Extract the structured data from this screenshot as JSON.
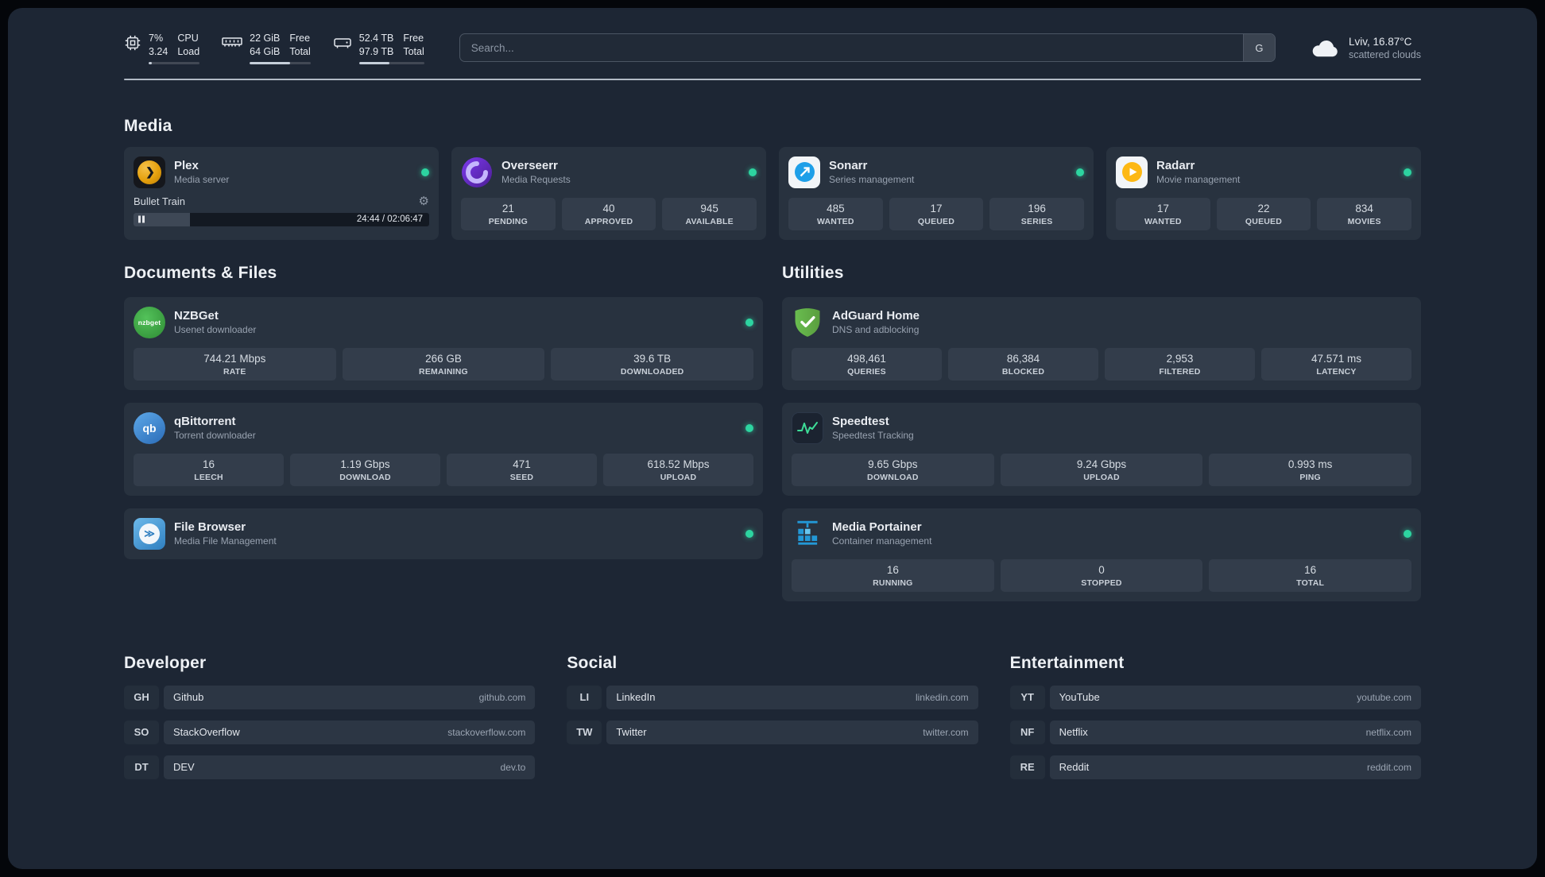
{
  "colors": {
    "background": "#1d2634",
    "card": "#28323f",
    "stat_tile": "#333d4b",
    "status_online": "#2dd4a0",
    "plex_accent": "#e5a00d",
    "overseerr_accent": "#7c3aed",
    "sonarr_accent": "#1e9fe8",
    "radarr_accent": "#fdb813",
    "nzbget_accent": "#3faa44",
    "qbittorrent_accent": "#4581d2",
    "filebrowser_accent": "#2f7fc0",
    "adguard_accent": "#69bd4f",
    "speedtest_accent": "#3ddc97",
    "portainer_accent": "#2398d6"
  },
  "topbar": {
    "cpu": {
      "icon": "cpu-chip-icon",
      "value_top": "7%",
      "value_bottom": "3.24",
      "label_top": "CPU",
      "label_bottom": "Load",
      "progress_percent": 7
    },
    "memory": {
      "icon": "memory-icon",
      "value_top": "22 GiB",
      "value_bottom": "64 GiB",
      "label_top": "Free",
      "label_bottom": "Total",
      "progress_percent": 66
    },
    "disk": {
      "icon": "hard-disk-icon",
      "value_top": "52.4 TB",
      "value_bottom": "97.9 TB",
      "label_top": "Free",
      "label_bottom": "Total",
      "progress_percent": 47
    },
    "search": {
      "placeholder": "Search...",
      "engine_button": "G"
    },
    "weather": {
      "icon": "cloud-icon",
      "location": "Lviv, 16.87°C",
      "condition": "scattered clouds"
    }
  },
  "media": {
    "title": "Media",
    "plex": {
      "name": "Plex",
      "subtitle": "Media server",
      "status": "online",
      "now_playing": "Bullet Train",
      "time_display": "24:44 / 02:06:47",
      "progress_percent": 19
    },
    "overseerr": {
      "name": "Overseerr",
      "subtitle": "Media Requests",
      "status": "online",
      "stats": [
        {
          "value": "21",
          "label": "PENDING"
        },
        {
          "value": "40",
          "label": "APPROVED"
        },
        {
          "value": "945",
          "label": "AVAILABLE"
        }
      ]
    },
    "sonarr": {
      "name": "Sonarr",
      "subtitle": "Series management",
      "status": "online",
      "stats": [
        {
          "value": "485",
          "label": "WANTED"
        },
        {
          "value": "17",
          "label": "QUEUED"
        },
        {
          "value": "196",
          "label": "SERIES"
        }
      ]
    },
    "radarr": {
      "name": "Radarr",
      "subtitle": "Movie management",
      "status": "online",
      "stats": [
        {
          "value": "17",
          "label": "WANTED"
        },
        {
          "value": "22",
          "label": "QUEUED"
        },
        {
          "value": "834",
          "label": "MOVIES"
        }
      ]
    }
  },
  "documents": {
    "title": "Documents & Files",
    "nzbget": {
      "name": "NZBGet",
      "subtitle": "Usenet downloader",
      "status": "online",
      "stats": [
        {
          "value": "744.21 Mbps",
          "label": "RATE"
        },
        {
          "value": "266 GB",
          "label": "REMAINING"
        },
        {
          "value": "39.6 TB",
          "label": "DOWNLOADED"
        }
      ]
    },
    "qbittorrent": {
      "name": "qBittorrent",
      "subtitle": "Torrent downloader",
      "status": "online",
      "stats": [
        {
          "value": "16",
          "label": "LEECH"
        },
        {
          "value": "1.19 Gbps",
          "label": "DOWNLOAD"
        },
        {
          "value": "471",
          "label": "SEED"
        },
        {
          "value": "618.52 Mbps",
          "label": "UPLOAD"
        }
      ]
    },
    "filebrowser": {
      "name": "File Browser",
      "subtitle": "Media File Management",
      "status": "online"
    }
  },
  "utilities": {
    "title": "Utilities",
    "adguard": {
      "name": "AdGuard Home",
      "subtitle": "DNS and adblocking",
      "status": "online",
      "stats": [
        {
          "value": "498,461",
          "label": "QUERIES"
        },
        {
          "value": "86,384",
          "label": "BLOCKED"
        },
        {
          "value": "2,953",
          "label": "FILTERED"
        },
        {
          "value": "47.571 ms",
          "label": "LATENCY"
        }
      ]
    },
    "speedtest": {
      "name": "Speedtest",
      "subtitle": "Speedtest Tracking",
      "status": "online",
      "stats": [
        {
          "value": "9.65 Gbps",
          "label": "DOWNLOAD"
        },
        {
          "value": "9.24 Gbps",
          "label": "UPLOAD"
        },
        {
          "value": "0.993 ms",
          "label": "PING"
        }
      ]
    },
    "portainer": {
      "name": "Media Portainer",
      "subtitle": "Container management",
      "status": "online",
      "stats": [
        {
          "value": "16",
          "label": "RUNNING"
        },
        {
          "value": "0",
          "label": "STOPPED"
        },
        {
          "value": "16",
          "label": "TOTAL"
        }
      ]
    }
  },
  "bookmarks": {
    "developer": {
      "title": "Developer",
      "items": [
        {
          "abbr": "GH",
          "name": "Github",
          "domain": "github.com"
        },
        {
          "abbr": "SO",
          "name": "StackOverflow",
          "domain": "stackoverflow.com"
        },
        {
          "abbr": "DT",
          "name": "DEV",
          "domain": "dev.to"
        }
      ]
    },
    "social": {
      "title": "Social",
      "items": [
        {
          "abbr": "LI",
          "name": "LinkedIn",
          "domain": "linkedin.com"
        },
        {
          "abbr": "TW",
          "name": "Twitter",
          "domain": "twitter.com"
        }
      ]
    },
    "entertainment": {
      "title": "Entertainment",
      "items": [
        {
          "abbr": "YT",
          "name": "YouTube",
          "domain": "youtube.com"
        },
        {
          "abbr": "NF",
          "name": "Netflix",
          "domain": "netflix.com"
        },
        {
          "abbr": "RE",
          "name": "Reddit",
          "domain": "reddit.com"
        }
      ]
    }
  }
}
